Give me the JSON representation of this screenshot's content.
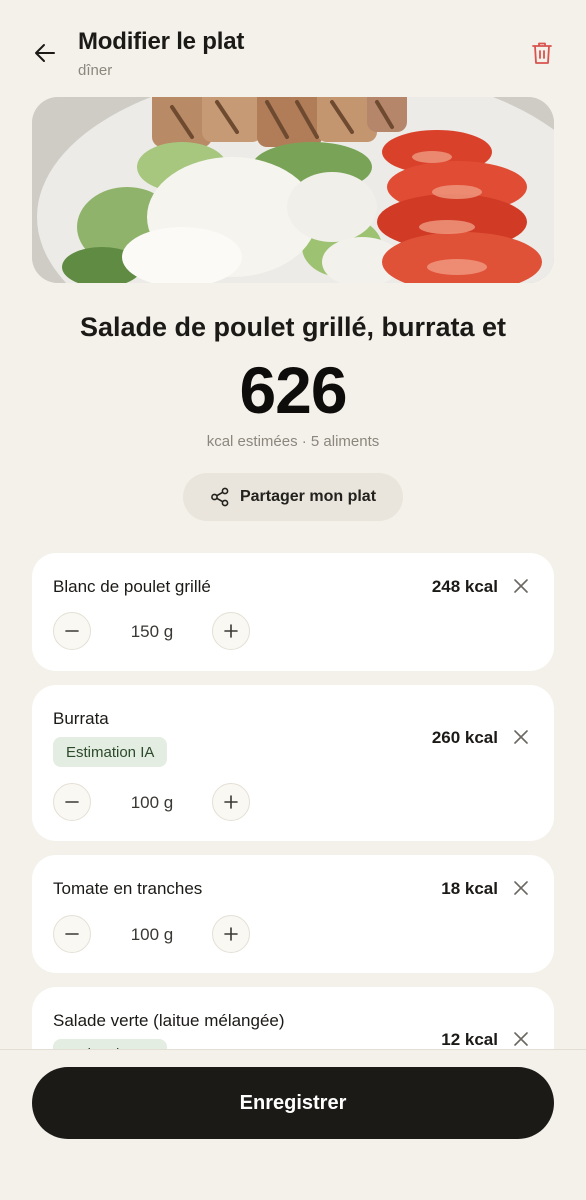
{
  "header": {
    "title": "Modifier le plat",
    "subtitle": "dîner",
    "back_icon": "arrow-left-icon",
    "delete_icon": "trash-icon",
    "delete_color": "#d9534f"
  },
  "meal": {
    "name": "Salade de poulet grillé, burrata et",
    "kcal": "626",
    "meta": "kcal estimées · 5 aliments"
  },
  "share": {
    "label": "Partager mon plat",
    "icon": "share-icon"
  },
  "foods": [
    {
      "name": "Blanc de poulet grillé",
      "kcal": "248 kcal",
      "qty": "150 g",
      "badge": ""
    },
    {
      "name": "Burrata",
      "kcal": "260 kcal",
      "qty": "100 g",
      "badge": "Estimation IA"
    },
    {
      "name": "Tomate en tranches",
      "kcal": "18 kcal",
      "qty": "100 g",
      "badge": ""
    },
    {
      "name": "Salade verte (laitue mélangée)",
      "kcal": "12 kcal",
      "qty": "",
      "badge": "Estimation IA"
    }
  ],
  "footer": {
    "save_label": "Enregistrer"
  },
  "colors": {
    "background": "#f4f1ea",
    "primary_button": "#1b1a17",
    "badge_bg": "#e3ede1"
  }
}
